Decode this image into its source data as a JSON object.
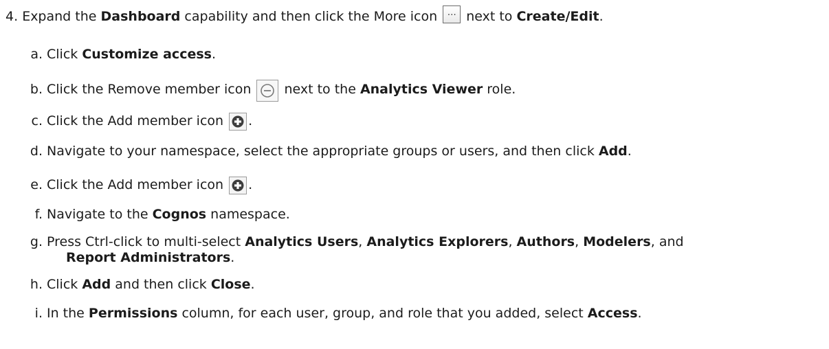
{
  "step4": {
    "number": "4.",
    "t1": "Expand the ",
    "b1": "Dashboard",
    "t2": " capability and then click the More icon ",
    "t3": " next to ",
    "b2": "Create/Edit",
    "t4": "."
  },
  "a": {
    "letter": "a.",
    "t1": "Click ",
    "b1": "Customize access",
    "t2": "."
  },
  "b": {
    "letter": "b.",
    "t1": "Click the Remove member icon ",
    "t2": " next to the ",
    "b1": "Analytics Viewer",
    "t3": " role."
  },
  "c": {
    "letter": "c.",
    "t1": "Click the Add member icon ",
    "t2": "."
  },
  "d": {
    "letter": "d.",
    "t1": "Navigate to your namespace, select the appropriate groups or users, and then click ",
    "b1": "Add",
    "t2": "."
  },
  "e": {
    "letter": "e.",
    "t1": "Click the Add member icon ",
    "t2": "."
  },
  "f": {
    "letter": "f.",
    "t1": "Navigate to the ",
    "b1": "Cognos",
    "t2": " namespace."
  },
  "g": {
    "letter": "g.",
    "t1": "Press Ctrl-click to multi-select ",
    "b1": "Analytics Users",
    "s1": ", ",
    "b2": "Analytics Explorers",
    "s2": ", ",
    "b3": "Authors",
    "s3": ", ",
    "b4": "Modelers",
    "s4": ", and",
    "b5": "Report Administrators",
    "s5": "."
  },
  "h": {
    "letter": "h.",
    "t1": "Click ",
    "b1": "Add",
    "t2": " and then click ",
    "b2": "Close",
    "t3": "."
  },
  "i": {
    "letter": "i.",
    "t1": "In the ",
    "b1": "Permissions",
    "t2": " column, for each user, group, and role that you added, select ",
    "b2": "Access",
    "t3": "."
  },
  "icons": {
    "more": "more-icon",
    "remove": "remove-member-icon",
    "add": "add-member-icon"
  }
}
